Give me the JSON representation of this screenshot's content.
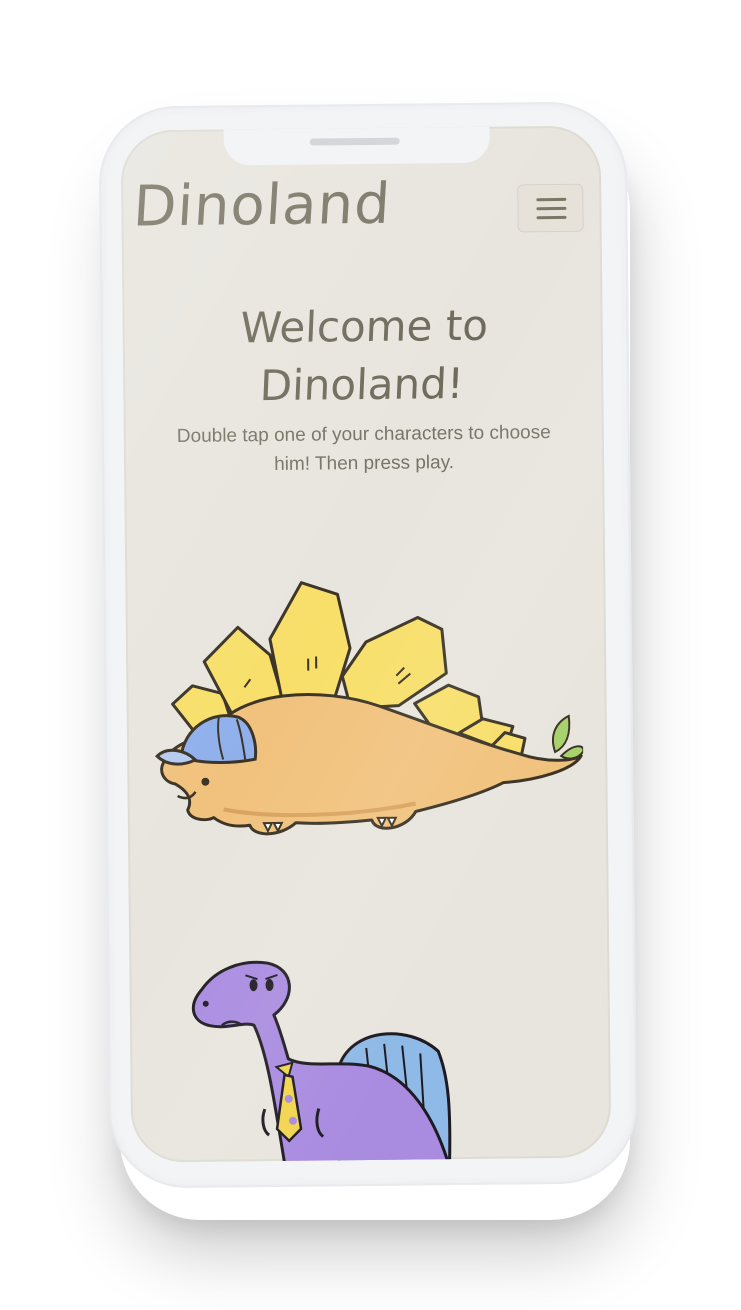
{
  "app": {
    "brand": "Dinoland"
  },
  "header": {
    "menu_icon": "hamburger-menu-icon"
  },
  "main": {
    "headline_line1": "Welcome to",
    "headline_line2": "Dinoland!",
    "instructions_line1": "Double tap one of your characters to choose",
    "instructions_line2": "him! Then press play."
  },
  "characters": [
    {
      "name": "stegosaurus-character",
      "accessory": "blue cap"
    },
    {
      "name": "purple-dino-character",
      "accessory": "yellow tie"
    }
  ],
  "colors": {
    "background": "#e8e5de",
    "text": "#6f6b5c",
    "stego_body": "#f1c27d",
    "stego_plates": "#f8df6a",
    "cap": "#8fb0ec",
    "purple_body": "#a98be0",
    "tie": "#f2d44d"
  }
}
